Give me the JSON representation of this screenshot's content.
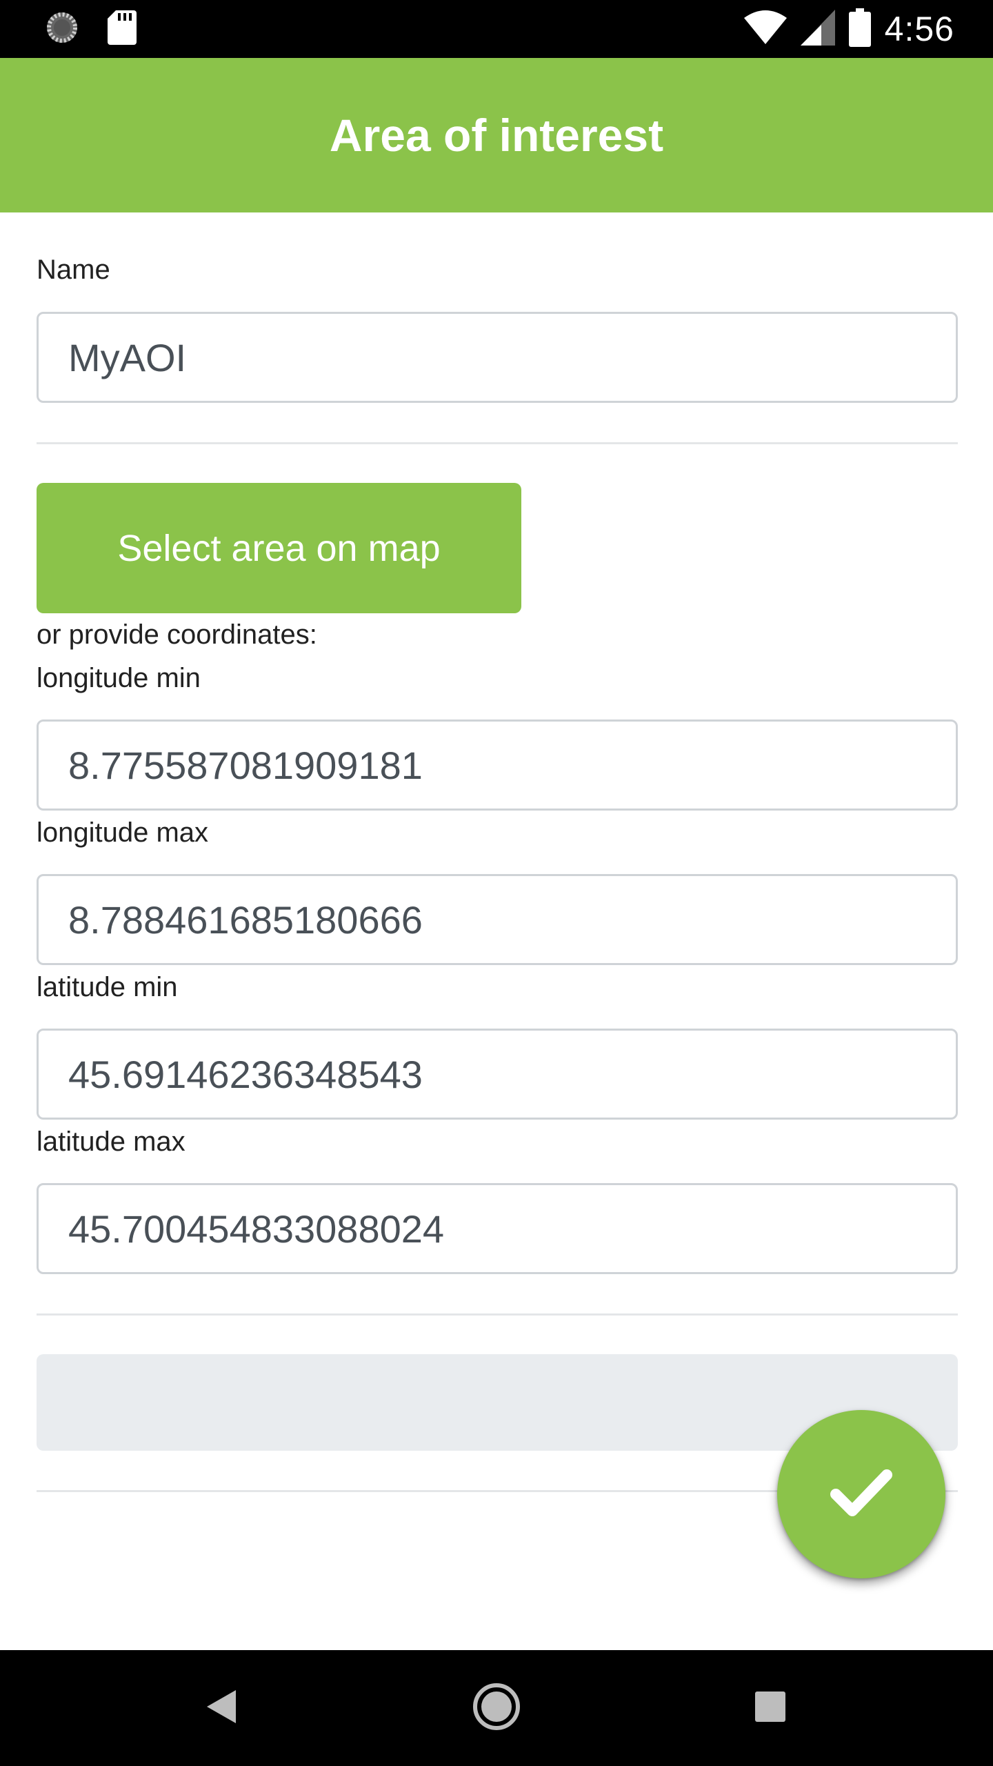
{
  "status_bar": {
    "time": "4:56",
    "icons": [
      "loading-circle-icon",
      "sd-card-icon",
      "wifi-icon",
      "cell-signal-icon",
      "battery-icon"
    ]
  },
  "app_bar": {
    "title": "Area of interest",
    "color": "#8bc34a"
  },
  "form": {
    "name_label": "Name",
    "name_value": "MyAOI",
    "select_map_button": "Select area on map",
    "or_coordinates_text": "or provide coordinates:",
    "longitude_min_label": "longitude min",
    "longitude_min_value": "8.775587081909181",
    "longitude_max_label": "longitude max",
    "longitude_max_value": "8.788461685180666",
    "latitude_min_label": "latitude min",
    "latitude_min_value": "45.69146236348543",
    "latitude_max_label": "latitude max",
    "latitude_max_value": "45.700454833088024"
  },
  "fab": {
    "icon": "check-icon"
  },
  "nav_bar": {
    "icons": [
      "back-icon",
      "home-icon",
      "recents-icon"
    ]
  },
  "colors": {
    "accent": "#8bc34a",
    "status_bar": "#000000",
    "field_border": "#cfd3d7",
    "placeholder_bar": "#e9ecef"
  }
}
